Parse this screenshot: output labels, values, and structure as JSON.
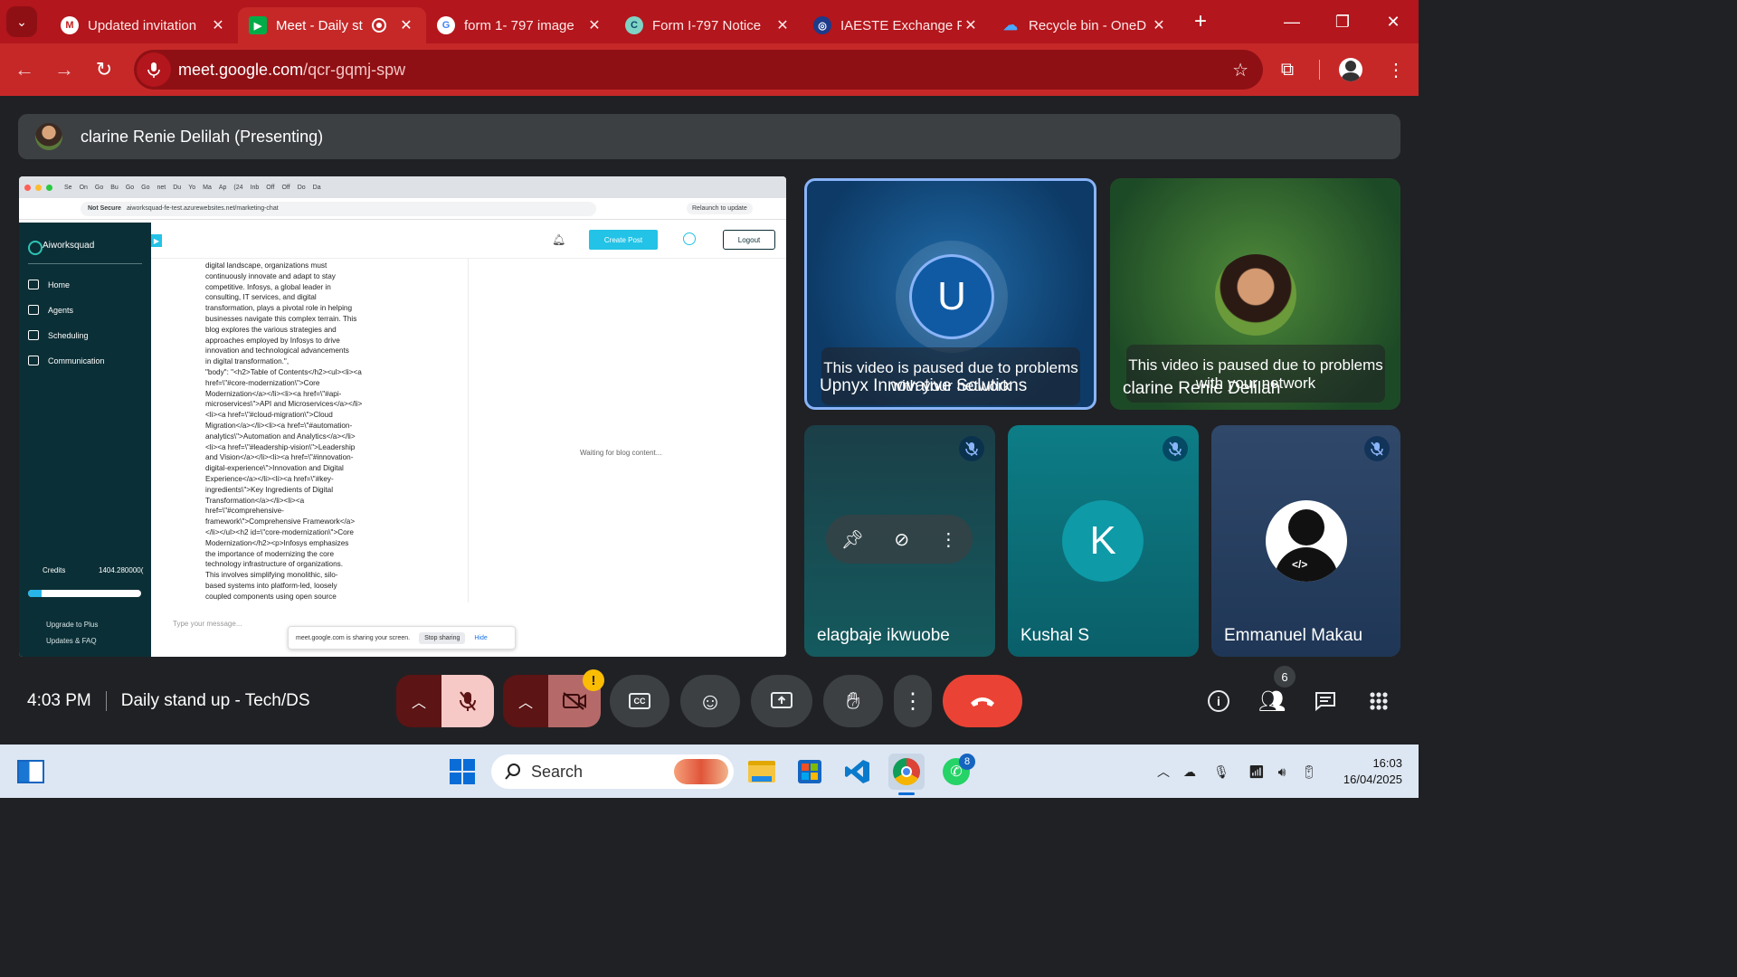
{
  "browser": {
    "tabs": [
      {
        "title": "Updated invitation",
        "icon": "gmail-icon",
        "active": false
      },
      {
        "title": "Meet - Daily st",
        "icon": "meet-icon",
        "active": true,
        "recording": true
      },
      {
        "title": "form 1- 797 image",
        "icon": "google-icon",
        "active": false
      },
      {
        "title": "Form I-797 Notice",
        "icon": "copilot-icon",
        "active": false
      },
      {
        "title": "IAESTE Exchange P",
        "icon": "iaeste-icon",
        "active": false
      },
      {
        "title": "Recycle bin - OneD",
        "icon": "onedrive-icon",
        "active": false
      }
    ],
    "url_host": "meet.google.com",
    "url_path": "/qcr-gqmj-spw",
    "theme_color": "#c62828"
  },
  "meet": {
    "presenter": "clarine Renie Delilah (Presenting)",
    "shared_screen": {
      "tabs": [
        "Se",
        "On",
        "Go",
        "Bu",
        "Go",
        "Go",
        "net",
        "Du",
        "Yo",
        "Ma",
        "Ap",
        "(24",
        "Inb",
        "Off",
        "Off",
        "Do",
        "Da"
      ],
      "not_secure": "Not Secure",
      "url": "aiworksquad-fe-test.azurewebsites.net/marketing-chat",
      "relaunch": "Relaunch to update",
      "brand": "Aiworksquad",
      "nav": [
        "Home",
        "Agents",
        "Scheduling",
        "Communication"
      ],
      "credits_label": "Credits",
      "credits_value": "1404.280000(",
      "credits_progress": 0.12,
      "upgrade": "Upgrade to Plus",
      "updates": "Updates & FAQ",
      "create_post": "Create Post",
      "logout": "Logout",
      "blog_text": "digital landscape, organizations must\ncontinuously innovate and adapt to stay\ncompetitive. Infosys, a global leader in\nconsulting, IT services, and digital\ntransformation, plays a pivotal role in helping\nbusinesses navigate this complex terrain. This\nblog explores the various strategies and\napproaches employed by Infosys to drive\ninnovation and technological advancements\nin digital transformation.\",\n\"body\": \"<h2>Table of Contents</h2><ul><li><a\nhref=\\\"#core-modernization\\\">Core\nModernization</a></li><li><a href=\\\"#api-\nmicroservices\\\">API and Microservices</a></li>\n<li><a href=\\\"#cloud-migration\\\">Cloud\nMigration</a></li><li><a href=\\\"#automation-\nanalytics\\\">Automation and Analytics</a></li>\n<li><a href=\\\"#leadership-vision\\\">Leadership\nand Vision</a></li><li><a href=\\\"#innovation-\ndigital-experience\\\">Innovation and Digital\nExperience</a></li><li><a href=\\\"#key-\ningredients\\\">Key Ingredients of Digital\nTransformation</a></li><li><a\nhref=\\\"#comprehensive-\nframework\\\">Comprehensive Framework</a>\n</li></ul><h2 id=\\\"core-modernization\\\">Core\nModernization</h2><p>Infosys emphasizes\nthe importance of modernizing the core\ntechnology infrastructure of organizations.\nThis involves simplifying monolithic, silo-\nbased systems into platform-led, loosely\ncoupled components using open source",
      "waiting": "Waiting for blog content...",
      "input_placeholder": "Type your message...",
      "sharing_note": "meet.google.com is sharing your screen.",
      "stop_sharing": "Stop sharing",
      "hide": "Hide"
    },
    "tiles": {
      "upnyx": {
        "name": "Upnyx Innovative Solutions",
        "initial": "U",
        "paused": "This video is paused due to problems with your network"
      },
      "clarine": {
        "name": "clarine Renie Delilah",
        "paused": "This video is paused due to problems with your network"
      },
      "elagbaje": {
        "name": "elagbaje ikwuobe"
      },
      "kushal": {
        "name": "Kushal S",
        "initial": "K"
      },
      "emmanuel": {
        "name": "Emmanuel Makau",
        "avatar_text": "</>"
      }
    },
    "time": "4:03 PM",
    "meeting_title": "Daily stand up - Tech/DS",
    "people_count": "6",
    "alert_badge": "!"
  },
  "taskbar": {
    "search_label": "Search",
    "whatsapp_badge": "8",
    "clock_time": "16:03",
    "clock_date": "16/04/2025"
  }
}
